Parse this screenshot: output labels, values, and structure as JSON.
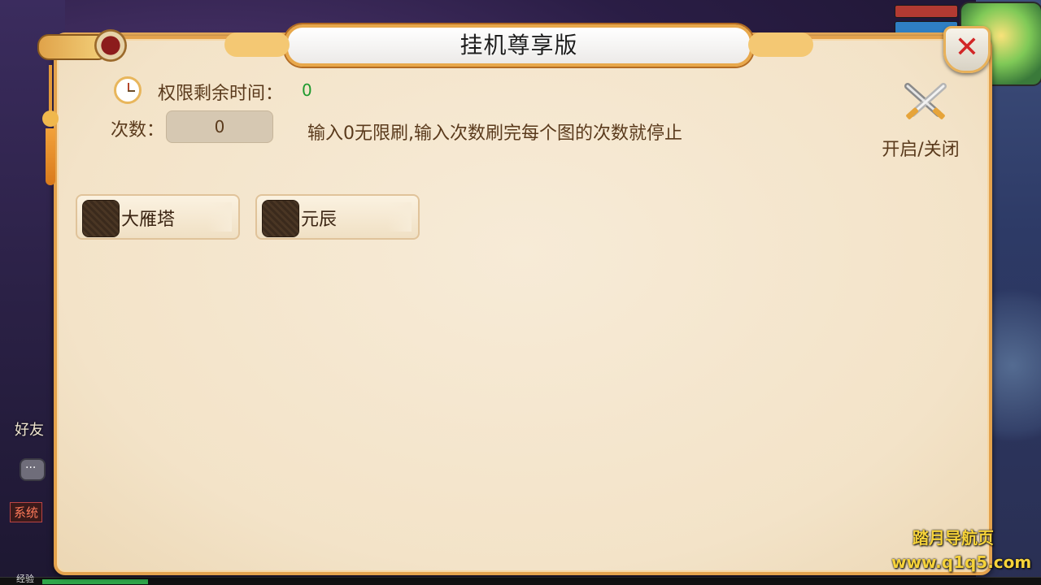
{
  "window": {
    "title": "挂机尊享版",
    "close_icon": "close-icon"
  },
  "status": {
    "time_label": "权限剩余时间：",
    "time_value": "0"
  },
  "count": {
    "label": "次数：",
    "value": "0",
    "hint": "输入0无限刷,输入次数刷完每个图的次数就停止"
  },
  "toggle": {
    "label": "开启/关闭",
    "icon": "crossed-swords-icon"
  },
  "maps": [
    {
      "label": "大雁塔",
      "checked": false
    },
    {
      "label": "元辰",
      "checked": false
    }
  ],
  "sidebar": {
    "friends_label": "好友",
    "system_label": "系统"
  },
  "footer": {
    "exp_label": "经验"
  },
  "watermark": {
    "line1": "踏月导航页",
    "line2": "www.q1q5.com"
  },
  "colors": {
    "panel_border": "#e3a24d",
    "text_brown": "#5a3a1c",
    "value_green": "#1e9a2e",
    "close_red": "#d22626"
  }
}
